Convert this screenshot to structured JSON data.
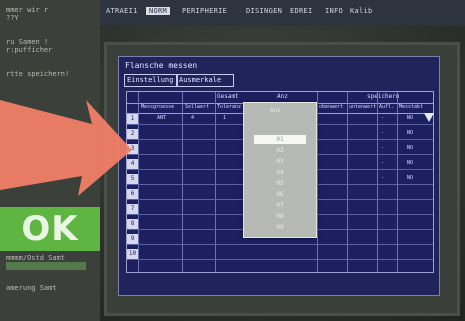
{
  "left_panel": {
    "lines": [
      "mmer wir r",
      "??Y",
      "",
      "ru Samen !",
      "r:pufficher",
      "",
      "rtte speichern!"
    ],
    "ok_label": "OK",
    "bottom_lines": [
      "mmmm/Ostd Samt",
      "",
      "amerung Samt"
    ]
  },
  "menubar": {
    "items": [
      {
        "label": "ATRAEI1"
      },
      {
        "label": "NORM",
        "active": true
      },
      {
        "label": "PERIPHERIE"
      },
      {
        "label": "DISINGEN"
      },
      {
        "label": "EDREI"
      },
      {
        "label": "INFO"
      },
      {
        "label": "Kalib"
      }
    ]
  },
  "dialog": {
    "title": "Flansche messen",
    "tabs": [
      "Einstellung",
      "Ausmerkale"
    ],
    "header_row1": [
      "Gesamt",
      "Anz",
      "speichern"
    ],
    "header_row2": [
      "Messgroesse",
      "Sollwert",
      "Toleranz",
      "obenwert",
      "untenwert",
      "Aufl.",
      "Messtakt"
    ],
    "first_row": [
      "ANT",
      "4",
      "1"
    ],
    "row_numbers": [
      "1",
      "2",
      "3",
      "4",
      "5",
      "6",
      "7",
      "8",
      "9",
      "10"
    ],
    "dropdown_items": [
      "01",
      "02",
      "03",
      "04",
      "05",
      "06",
      "07",
      "08",
      "09",
      "10"
    ],
    "dropdown_selected_index": 0,
    "col_tail_values": [
      "-",
      "NO",
      "-",
      "NO",
      "-",
      "NO",
      "-",
      "NO",
      "-",
      "NO"
    ]
  },
  "colors": {
    "dialog_bg": "#20245a",
    "ok_green": "#5fb541",
    "arrow": "#f07e66"
  },
  "icons": {
    "pointer_arrow": "annotation-arrow-icon",
    "dropdown": "triangle-down-icon"
  }
}
